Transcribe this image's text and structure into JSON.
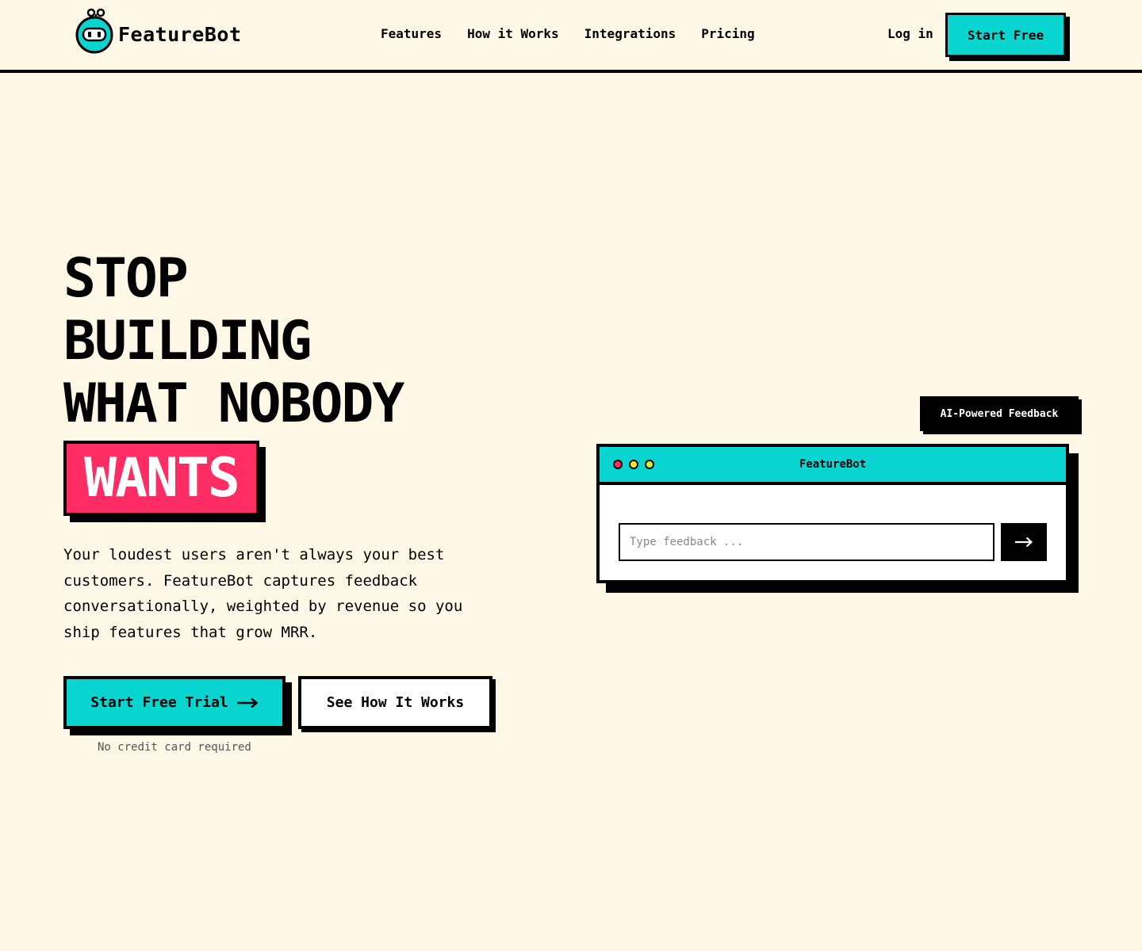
{
  "brand": {
    "name": "FeatureBot",
    "accent": "#08d4d0",
    "highlight": "#ff2d64",
    "background": "#fff8e7"
  },
  "nav": {
    "links": [
      "Features",
      "How it Works",
      "Integrations",
      "Pricing"
    ],
    "login": "Log in",
    "cta": "Start Free"
  },
  "hero": {
    "headline_lines": [
      "STOP",
      "BUILDING",
      "WHAT NOBODY"
    ],
    "highlight_word": "WANTS",
    "subcopy": "Your loudest users aren't always your best customers. FeatureBot captures feedback conversationally, weighted by revenue so you ship features that grow MRR.",
    "primary_cta": "Start Free Trial",
    "primary_cta_icon": "arrow-right-icon",
    "secondary_cta": "See How It Works",
    "note": "No credit card required"
  },
  "widget": {
    "badge": "AI-Powered Feedback",
    "window_title": "FeatureBot",
    "dot_colors": [
      "#ff2d64",
      "#ffe81f",
      "#c6f432"
    ],
    "input_placeholder": "Type feedback ...",
    "send_icon": "arrow-right-icon"
  }
}
